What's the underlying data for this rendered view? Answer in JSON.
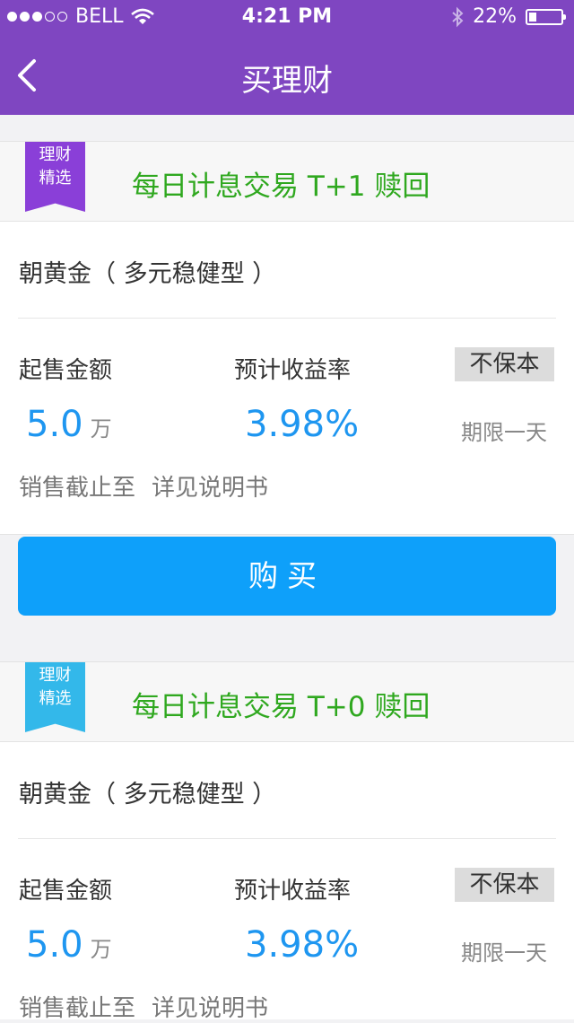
{
  "status_bar": {
    "carrier": "BELL",
    "time": "4:21 PM",
    "battery": "22%",
    "battery_level": 0.22,
    "signal_dots_filled": 3,
    "signal_dots_total": 5
  },
  "nav": {
    "title": "买理财",
    "back_icon": "chevron-left-icon"
  },
  "colors": {
    "nav_bg": "#7f46c1",
    "accent_blue": "#1e96f0",
    "tag_green": "#2fa81f",
    "ribbon_purple": "#8a3fd8",
    "ribbon_blue": "#33b8ea"
  },
  "products": [
    {
      "ribbon_line1": "理财",
      "ribbon_line2": "精选",
      "ribbon_color": "purple",
      "tagline": "每日计息交易 T+1 赎回",
      "name": "朝黄金（ 多元稳健型 ）",
      "min_amount_label": "起售金额",
      "min_amount_value": "5.0",
      "min_amount_unit": "万",
      "yield_label": "预计收益率",
      "yield_value": "3.98%",
      "guarantee_badge": "不保本",
      "term": "期限一天",
      "sale_end_label": "销售截止至",
      "sale_end_value": "详见说明书",
      "buy_label": "购买"
    },
    {
      "ribbon_line1": "理财",
      "ribbon_line2": "精选",
      "ribbon_color": "blue",
      "tagline": "每日计息交易 T+0 赎回",
      "name": "朝黄金（ 多元稳健型 ）",
      "min_amount_label": "起售金额",
      "min_amount_value": "5.0",
      "min_amount_unit": "万",
      "yield_label": "预计收益率",
      "yield_value": "3.98%",
      "guarantee_badge": "不保本",
      "term": "期限一天",
      "sale_end_label": "销售截止至",
      "sale_end_value": "详见说明书"
    }
  ]
}
